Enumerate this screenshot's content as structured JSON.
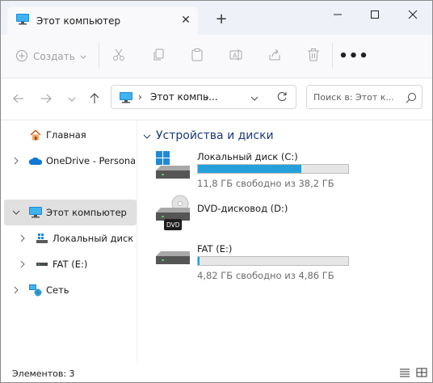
{
  "window": {
    "tab_title": "Этот компьютер",
    "tab_close": "✕",
    "new_tab": "+",
    "icons": [
      "this-pc-icon",
      "minimize-icon",
      "maximize-icon",
      "close-icon"
    ]
  },
  "toolbar": {
    "create_label": "Создать",
    "more_label": "•••",
    "icons": [
      "cut-icon",
      "copy-icon",
      "paste-icon",
      "rename-icon",
      "share-icon",
      "delete-icon"
    ]
  },
  "address": {
    "separator": "›",
    "path": [
      "Этот компь..."
    ],
    "trailing_separator": "›",
    "search_placeholder": "Поиск в: Этот к...",
    "icons": [
      "back-icon",
      "forward-icon",
      "recent-icon",
      "up-icon",
      "dropdown-icon",
      "refresh-icon",
      "search-icon"
    ]
  },
  "sidebar": {
    "items": [
      {
        "label": "Главная",
        "icon": "home-icon",
        "chevron": false,
        "selected": false
      },
      {
        "label": "OneDrive - Personal",
        "icon": "onedrive-icon",
        "chevron": true,
        "selected": false
      },
      {
        "label": "Этот компьютер",
        "icon": "this-pc-icon",
        "chevron": true,
        "expanded": true,
        "selected": true
      },
      {
        "label": "Локальный диск (C:)",
        "icon": "local-disk-icon",
        "chevron": true,
        "selected": false
      },
      {
        "label": "FAT (E:)",
        "icon": "drive-icon",
        "chevron": true,
        "selected": false
      },
      {
        "label": "Сеть",
        "icon": "network-icon",
        "chevron": true,
        "selected": false
      }
    ]
  },
  "content": {
    "section_title": "Устройства и диски",
    "drives": [
      {
        "name": "Локальный диск (C:)",
        "free_text": "11,8 ГБ свободно из 38,2 ГБ",
        "used_fraction": 0.69,
        "icon": "windows-drive-icon"
      },
      {
        "name": "DVD-дисковод (D:)",
        "dvd_label": "DVD",
        "icon": "dvd-drive-icon"
      },
      {
        "name": "FAT (E:)",
        "free_text": "4,82 ГБ свободно из 4,86 ГБ",
        "used_fraction": 0.01,
        "icon": "drive-icon"
      }
    ]
  },
  "status": {
    "items_count": "Элементов: 3",
    "icons": [
      "details-view-icon",
      "tiles-view-icon"
    ]
  },
  "colors": {
    "accent": "#26a0da",
    "selected_bg": "#e0e0e0",
    "title_bg": "#eef1f7",
    "section_title": "#1b3a7a"
  }
}
